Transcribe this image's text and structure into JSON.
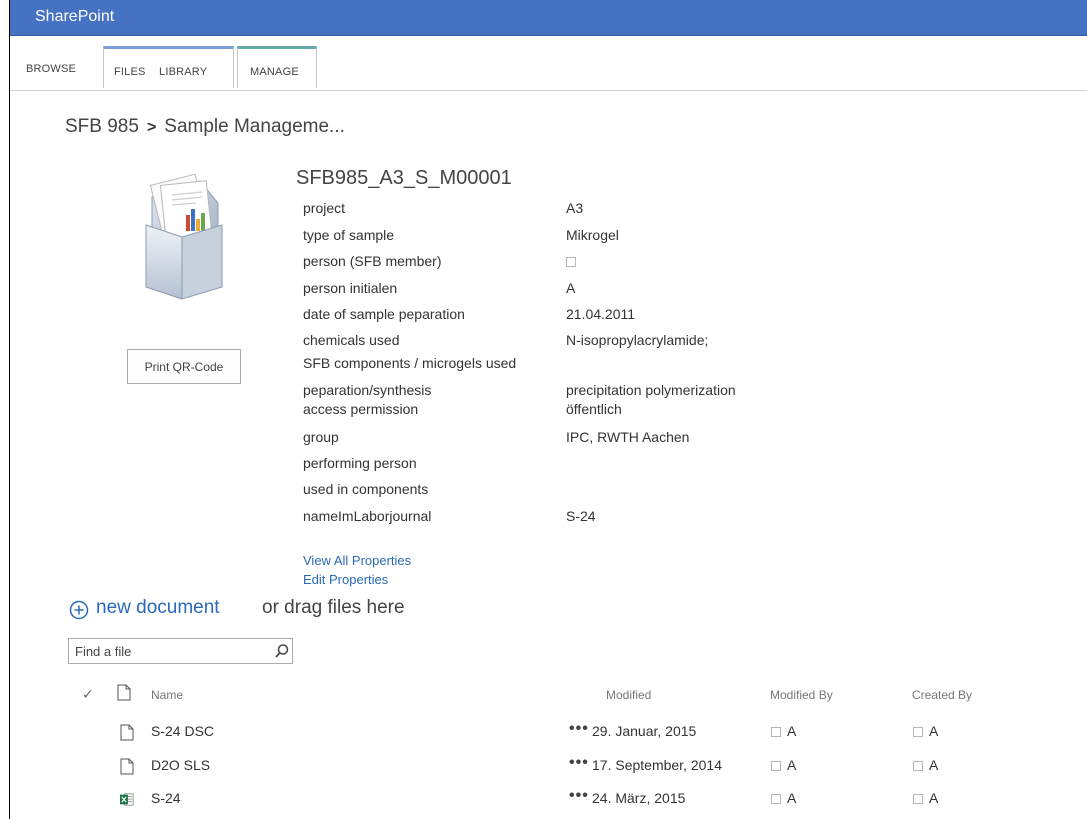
{
  "app": {
    "brand": "SharePoint"
  },
  "ribbon": {
    "tabs": [
      {
        "label": "BROWSE"
      },
      {
        "label": "FILES"
      },
      {
        "label": "LIBRARY"
      },
      {
        "label": "MANAGE"
      }
    ]
  },
  "breadcrumb": {
    "parent": "SFB 985",
    "separator": ">",
    "current": "Sample Manageme..."
  },
  "document": {
    "title": "SFB985_A3_S_M00001",
    "print_button": "Print QR-Code",
    "properties": [
      {
        "label": "project",
        "value": "A3"
      },
      {
        "label": "type of sample",
        "value": "Mikrogel"
      },
      {
        "label": "person (SFB member)",
        "value": ""
      },
      {
        "label": "person initialen",
        "value": "A"
      },
      {
        "label": "date of sample peparation",
        "value": "21.04.2011"
      },
      {
        "label": "chemicals used",
        "value": "N-isopropylacrylamide;"
      },
      {
        "label": "SFB components / microgels used",
        "value": ""
      },
      {
        "label": "peparation/synthesis",
        "value": "precipitation polymerization"
      },
      {
        "label": "access permission",
        "value": "öffentlich"
      },
      {
        "label": "group",
        "value": "IPC, RWTH Aachen"
      },
      {
        "label": "performing person",
        "value": ""
      },
      {
        "label": "used in components",
        "value": ""
      },
      {
        "label": "nameImLaborjournal",
        "value": "S-24"
      }
    ],
    "links": {
      "view_all": "View All Properties",
      "edit": "Edit Properties"
    }
  },
  "upload": {
    "link": "new document",
    "rest": "or drag files here"
  },
  "search": {
    "placeholder": "Find a file"
  },
  "table": {
    "headers": {
      "check": "✓",
      "name": "Name",
      "modified": "Modified",
      "modified_by": "Modified By",
      "created_by": "Created By"
    },
    "ellipsis": "•••",
    "rows": [
      {
        "name": "S-24 DSC",
        "modified": "29. Januar, 2015",
        "modified_by": "A",
        "created_by": "A",
        "icon": "file-icon"
      },
      {
        "name": "D2O SLS",
        "modified": "17. September, 2014",
        "modified_by": "A",
        "created_by": "A",
        "icon": "file-icon"
      },
      {
        "name": "S-24",
        "modified": "24. März, 2015",
        "modified_by": "A",
        "created_by": "A",
        "icon": "excel-icon"
      }
    ]
  },
  "colors": {
    "topbar": "#4672c4",
    "link": "#2a6ab7",
    "excel": "#1e7145"
  }
}
